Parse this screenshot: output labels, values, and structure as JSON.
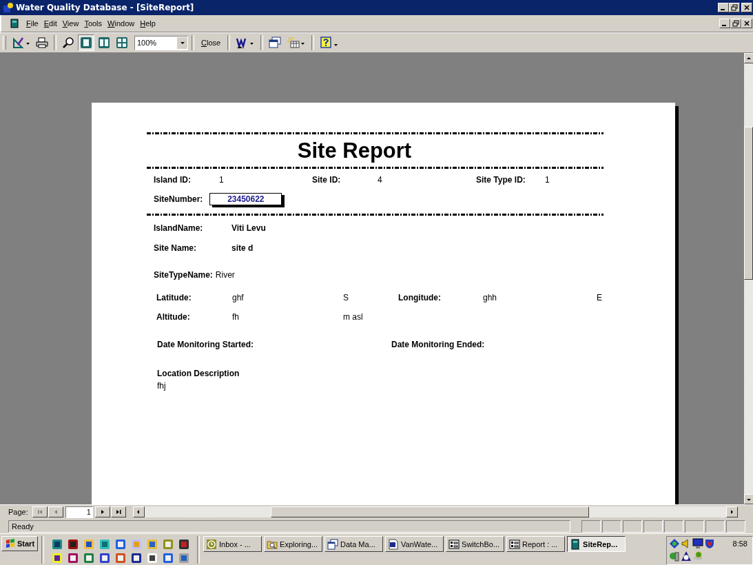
{
  "window": {
    "title": "Water Quality Database - [SiteReport]"
  },
  "menu": [
    "File",
    "Edit",
    "View",
    "Tools",
    "Window",
    "Help"
  ],
  "toolbar": {
    "page_views": [
      {
        "selected": true
      },
      {
        "selected": false
      },
      {
        "selected": false
      }
    ],
    "zoom": "100%",
    "close": "Close"
  },
  "report": {
    "title": "Site Report",
    "ids": [
      {
        "label": "Island ID:",
        "value": "1"
      },
      {
        "label": "Site ID:",
        "value": "4"
      },
      {
        "label": "Site Type ID:",
        "value": "1"
      }
    ],
    "site_number": {
      "label": "SiteNumber:",
      "value": "23450622"
    },
    "names": [
      {
        "label": "IslandName:",
        "value": "Viti Levu"
      },
      {
        "label": "Site Name:",
        "value": "site d"
      }
    ],
    "site_type": {
      "label": "SiteTypeName:",
      "value": "River"
    },
    "coordinates": [
      {
        "label": "Latitude:",
        "value": "ghf",
        "unit": "S",
        "label_2": "Longitude:",
        "value_2": "ghh",
        "unit_2": "E"
      },
      {
        "label": "Altitude:",
        "value": "fh",
        "unit": "m asl"
      }
    ],
    "dates": [
      "Date Monitoring Started:",
      "Date Monitoring Ended:"
    ],
    "location": {
      "label": "Location Description",
      "value": "fhj"
    }
  },
  "navigation": {
    "label": "Page:",
    "page": "1"
  },
  "status_bar": {
    "text": "Ready"
  },
  "taskbar": {
    "start": "Start",
    "tasks": [
      {
        "label": "Inbox - ...",
        "kind": "clock",
        "selected": false
      },
      {
        "label": "Exploring...",
        "kind": "search",
        "selected": false
      },
      {
        "label": "Data Ma...",
        "kind": "windows",
        "selected": false
      },
      {
        "label": "VanWate...",
        "kind": "word",
        "selected": false
      },
      {
        "label": "SwitchBo...",
        "kind": "form",
        "selected": false
      },
      {
        "label": "Report : ...",
        "kind": "form",
        "selected": false
      },
      {
        "label": "SiteRep...",
        "kind": "book",
        "selected": true
      }
    ],
    "clock": "8:58"
  }
}
